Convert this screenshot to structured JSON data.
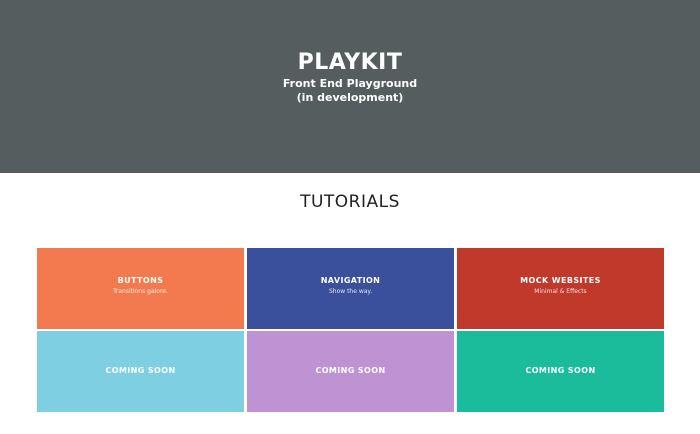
{
  "hero": {
    "title": "PLAYKIT",
    "subtitle_line1": "Front End Playground",
    "subtitle_line2": "(in development)"
  },
  "section": {
    "title": "TUTORIALS"
  },
  "tiles": [
    {
      "title": "BUTTONS",
      "subtitle": "Transitions galore.",
      "color": "#f27a4e"
    },
    {
      "title": "NAVIGATION",
      "subtitle": "Show the way.",
      "color": "#3b509c"
    },
    {
      "title": "MOCK WEBSITES",
      "subtitle": "Minimal & Effects",
      "color": "#c0392b"
    },
    {
      "title": "COMING SOON",
      "subtitle": "",
      "color": "#7ecfe2"
    },
    {
      "title": "COMING SOON",
      "subtitle": "",
      "color": "#bf92d4"
    },
    {
      "title": "COMING SOON",
      "subtitle": "",
      "color": "#1abc9c"
    }
  ],
  "colors": {
    "hero_bg": "#565d5f",
    "page_bg": "#ffffff"
  }
}
